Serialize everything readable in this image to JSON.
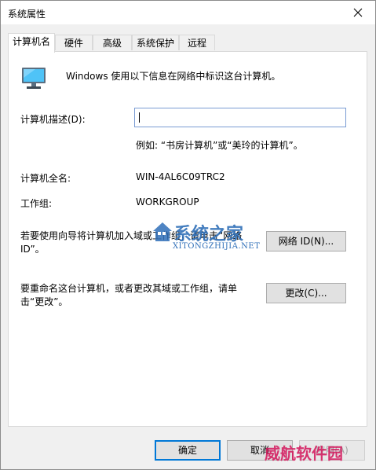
{
  "window": {
    "title": "系统属性"
  },
  "tabs": [
    {
      "label": "计算机名",
      "active": true
    },
    {
      "label": "硬件",
      "active": false
    },
    {
      "label": "高级",
      "active": false
    },
    {
      "label": "系统保护",
      "active": false
    },
    {
      "label": "远程",
      "active": false
    }
  ],
  "intro": {
    "text": "Windows 使用以下信息在网络中标识这台计算机。",
    "icon": "computer-monitor-icon"
  },
  "description": {
    "label": "计算机描述(D):",
    "value": "",
    "example": "例如: “书房计算机”或“美玲的计算机”。"
  },
  "full_name": {
    "label": "计算机全名:",
    "value": "WIN-4AL6C09TRC2"
  },
  "workgroup": {
    "label": "工作组:",
    "value": "WORKGROUP"
  },
  "network_id": {
    "text": "若要使用向导将计算机加入域或工作组，请单击“网络 ID”。",
    "button": "网络 ID(N)..."
  },
  "rename": {
    "text": "要重命名这台计算机，或者更改其域或工作组，请单击“更改”。",
    "button": "更改(C)..."
  },
  "footer": {
    "ok": "确定",
    "cancel": "取消",
    "apply": "应用(A)"
  },
  "watermarks": {
    "logo_text": "系统之家",
    "logo_subtext": "XITONGZHIJIA.NET",
    "corner_text": "威航软件园"
  }
}
